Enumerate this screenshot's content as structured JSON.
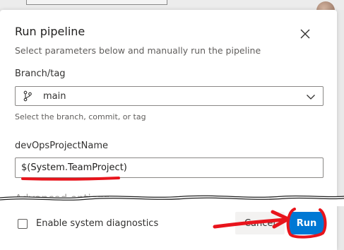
{
  "dialog": {
    "title": "Run pipeline",
    "subtitle": "Select parameters below and manually run the pipeline",
    "close_icon": "close-icon"
  },
  "branch": {
    "label": "Branch/tag",
    "value": "main",
    "hint": "Select the branch, commit, or tag",
    "icon": "git-branch-icon"
  },
  "project": {
    "label": "devOpsProjectName",
    "value": "$(System.TeamProject)"
  },
  "advanced": {
    "label": "Advanced options"
  },
  "footer": {
    "diagnostics_label": "Enable system diagnostics",
    "cancel_label": "Cancel",
    "run_label": "Run"
  },
  "colors": {
    "primary": "#0078d4",
    "annotation": "#e8141c"
  }
}
